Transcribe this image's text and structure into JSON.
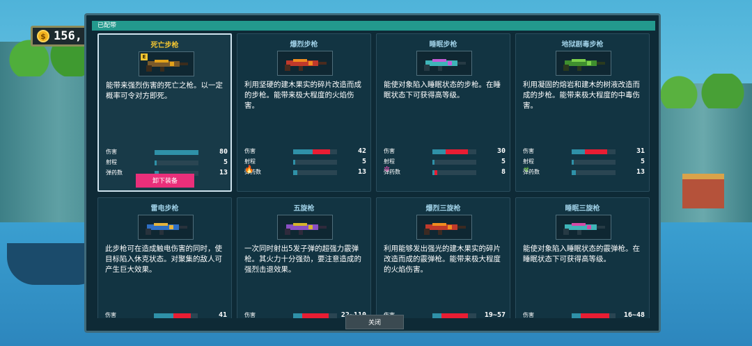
{
  "coins": {
    "value": "156,"
  },
  "panel": {
    "header": "已配带",
    "close_label": "关闭",
    "unequip_label": "卸下装备"
  },
  "colors": {
    "stat_base": "#2f91a8",
    "stat_bonus": "#e81d33",
    "selected_title": "#f2c531",
    "unequip_button": "#ea2f7a",
    "header_bar": "#23998d"
  },
  "weapons": [
    {
      "name": "死亡步枪",
      "selected": true,
      "equipped_badge": "E",
      "gun_icon": "death-rifle-icon",
      "gun_colors": [
        "#7a5a2a",
        "#e2a21a",
        "#3b2c1c"
      ],
      "description": "能带来强烈伤害的死亡之枪。以一定概率可令对方即死。",
      "stats": [
        {
          "label": "伤害",
          "value": "80",
          "base": 1.0,
          "bonus": 0.0
        },
        {
          "label": "射程",
          "value": "5",
          "base": 0.05,
          "bonus": 0.0
        },
        {
          "label": "弹药数",
          "value": "13",
          "base": 0.1,
          "bonus": 0.0
        }
      ],
      "effect_icon": null
    },
    {
      "name": "爆烈步枪",
      "selected": false,
      "gun_icon": "blast-rifle-icon",
      "gun_colors": [
        "#c0392b",
        "#f08c1f",
        "#4a2b1e"
      ],
      "description": "利用坚硬的建木果实的碎片改造而成的步枪。能带来极大程度的火焰伤害。",
      "stats": [
        {
          "label": "伤害",
          "value": "42",
          "base": 0.45,
          "bonus": 0.4
        },
        {
          "label": "射程",
          "value": "5",
          "base": 0.05,
          "bonus": 0.0
        },
        {
          "label": "弹药数",
          "value": "13",
          "base": 0.1,
          "bonus": 0.0
        }
      ],
      "effect_icon": "fire-icon"
    },
    {
      "name": "睡眠步枪",
      "selected": false,
      "gun_icon": "sleep-rifle-icon",
      "gun_colors": [
        "#3fb4b8",
        "#c45ad6",
        "#263a44"
      ],
      "description": "能使对象陷入睡眠状态的步枪。在睡眠状态下可获得高等级。",
      "stats": [
        {
          "label": "伤害",
          "value": "30",
          "base": 0.3,
          "bonus": 0.5
        },
        {
          "label": "射程",
          "value": "5",
          "base": 0.05,
          "bonus": 0.0
        },
        {
          "label": "弹药数",
          "value": "8",
          "base": 0.05,
          "bonus": 0.07
        }
      ],
      "effect_icon": "sleep-icon"
    },
    {
      "name": "地狱剧毒步枪",
      "selected": false,
      "gun_icon": "poison-rifle-icon",
      "gun_colors": [
        "#3f8f2f",
        "#7bd14a",
        "#2a3a1e"
      ],
      "description": "利用凝固的熔岩和建木的树液改造而成的步枪。能带来极大程度的中毒伤害。",
      "stats": [
        {
          "label": "伤害",
          "value": "31",
          "base": 0.3,
          "bonus": 0.5
        },
        {
          "label": "射程",
          "value": "5",
          "base": 0.05,
          "bonus": 0.0
        },
        {
          "label": "弹药数",
          "value": "13",
          "base": 0.1,
          "bonus": 0.0
        }
      ],
      "effect_icon": "biohazard-icon"
    },
    {
      "name": "雷电步枪",
      "selected": false,
      "gun_icon": "thunder-rifle-icon",
      "gun_colors": [
        "#2f6fc4",
        "#e6b43a",
        "#28323c"
      ],
      "description": "此步枪可在造成触电伤害的同时，使目标陷入休克状态。对聚集的敌人可产生巨大效果。",
      "stats": [
        {
          "label": "伤害",
          "value": "41",
          "base": 0.45,
          "bonus": 0.4
        }
      ],
      "effect_icon": null
    },
    {
      "name": "五旋枪",
      "selected": false,
      "gun_icon": "five-spin-gun-icon",
      "gun_colors": [
        "#8a4fc4",
        "#d6b52a",
        "#2f2a3c"
      ],
      "description": "一次同时射出5发子弹的超强力霰弹枪。其火力十分强劲，要注意造成的强烈击退效果。",
      "stats": [
        {
          "label": "伤害",
          "value": "22~110",
          "base": 0.2,
          "bonus": 0.6
        }
      ],
      "effect_icon": null
    },
    {
      "name": "爆烈三旋枪",
      "selected": false,
      "gun_icon": "blast-triple-gun-icon",
      "gun_colors": [
        "#c0392b",
        "#f08c1f",
        "#3c2a22"
      ],
      "description": "利用能够发出强光的建木果实的碎片改造而成的霰弹枪。能带来极大程度的火焰伤害。",
      "stats": [
        {
          "label": "伤害",
          "value": "19~57",
          "base": 0.2,
          "bonus": 0.6
        }
      ],
      "effect_icon": null
    },
    {
      "name": "睡眠三旋枪",
      "selected": false,
      "gun_icon": "sleep-triple-gun-icon",
      "gun_colors": [
        "#3fb4b8",
        "#d64aa6",
        "#263a44"
      ],
      "description": "能使对象陷入睡眠状态的霰弹枪。在睡眠状态下可获得高等级。",
      "stats": [
        {
          "label": "伤害",
          "value": "16~48",
          "base": 0.2,
          "bonus": 0.65
        }
      ],
      "effect_icon": null
    }
  ]
}
